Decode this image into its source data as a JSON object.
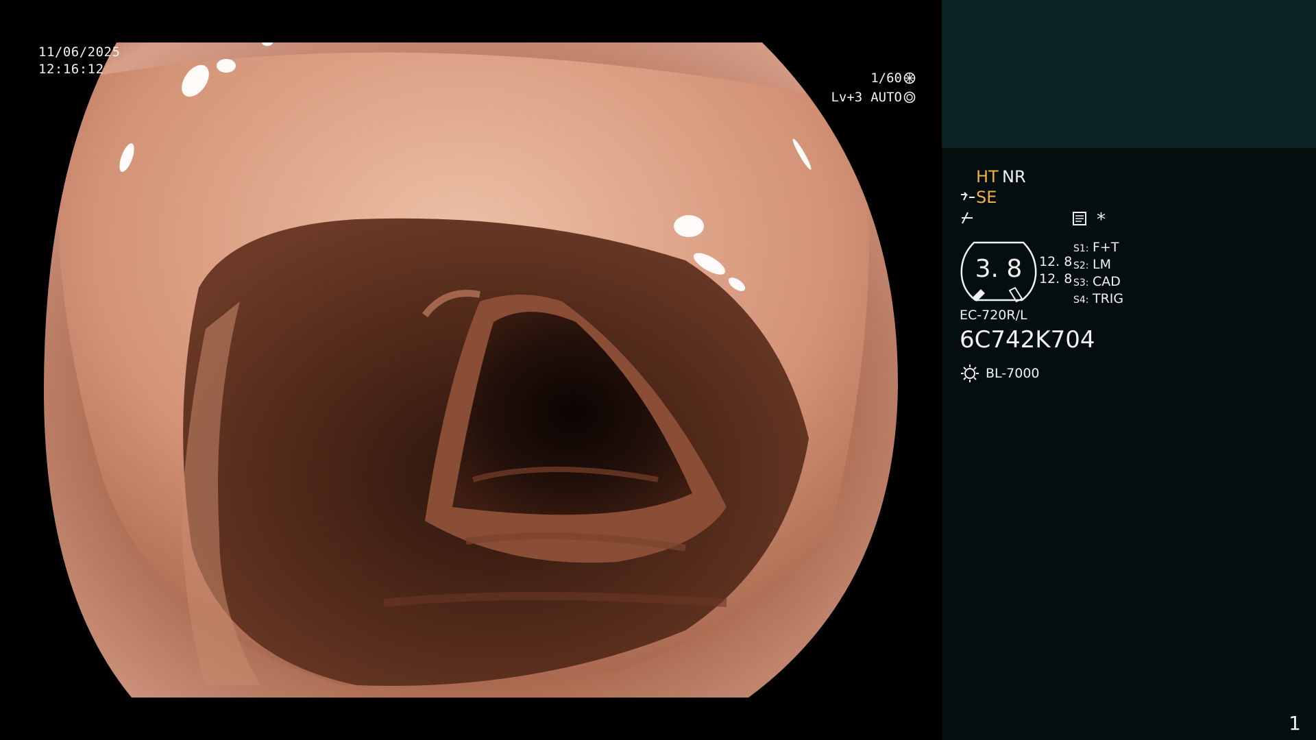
{
  "overlay": {
    "date": "11/06/2025",
    "time": "12:16:12",
    "shutter_speed": "1/60",
    "exposure": "Lv+3",
    "iris_mode": "AUTO"
  },
  "panel": {
    "modes": {
      "ht": "HT",
      "nr": "NR",
      "se": "SE"
    },
    "icons": [
      "scope-mode-icon",
      "enhancement-icon",
      "memo-icon",
      "asterisk-icon",
      "lamp-icon"
    ],
    "asterisk": "*",
    "gauge_value": "3. 8",
    "values": [
      "12. 8",
      "12. 8"
    ],
    "switches": [
      {
        "key": "S1:",
        "value": "F+T"
      },
      {
        "key": "S2:",
        "value": "LM"
      },
      {
        "key": "S3:",
        "value": "CAD"
      },
      {
        "key": "S4:",
        "value": "TRIG"
      }
    ],
    "scope_model": "EC-720R/L",
    "scope_serial": "6C742K704",
    "light_source": "BL-7000",
    "page_number": "1"
  },
  "colors": {
    "orange": "#f5b13d",
    "panel_bg": "#050e0e",
    "panel_top": "#0b2324"
  }
}
